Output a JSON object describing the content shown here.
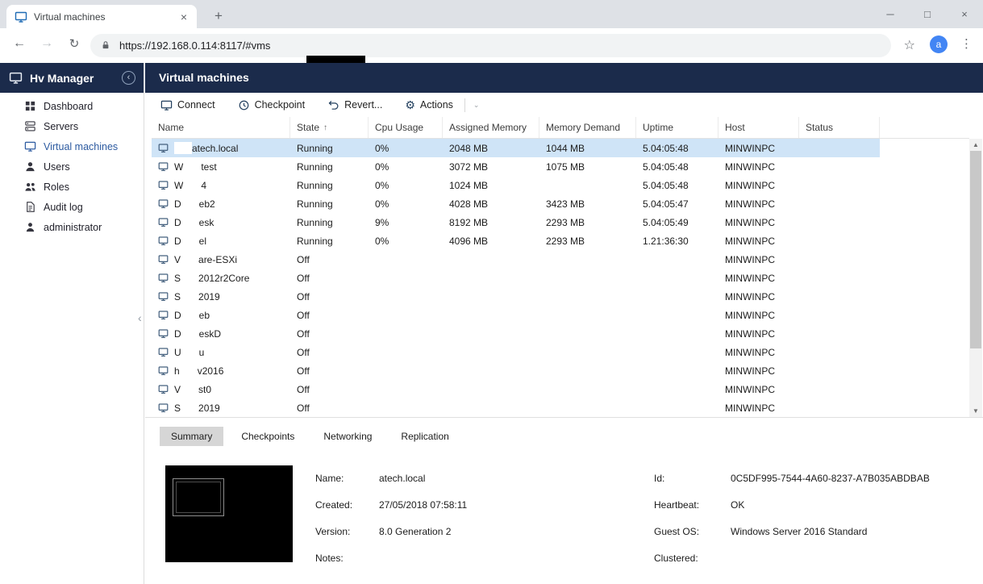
{
  "theme": {
    "navy": "#1b2b4b",
    "accent": "#2c5aa0",
    "row_selected": "#cfe4f7"
  },
  "browser": {
    "tab_title": "Virtual machines",
    "close_tab_glyph": "×",
    "new_tab_glyph": "+",
    "minimize_glyph": "─",
    "maximize_glyph": "□",
    "close_glyph": "×",
    "back_glyph": "←",
    "forward_glyph": "→",
    "reload_glyph": "↻",
    "url": "https://192.168.0.114:8117/#vms",
    "star_glyph": "☆",
    "avatar_letter": "a",
    "menu_glyph": "⋮"
  },
  "sidebar": {
    "title": "Hv Manager",
    "collapse_glyph": "‹",
    "items": [
      {
        "label": "Dashboard"
      },
      {
        "label": "Servers"
      },
      {
        "label": "Virtual machines",
        "selected": true
      },
      {
        "label": "Users"
      },
      {
        "label": "Roles"
      },
      {
        "label": "Audit log"
      },
      {
        "label": "administrator"
      }
    ]
  },
  "header": {
    "title": "Virtual machines"
  },
  "toolbar": {
    "buttons": [
      {
        "label": "Connect"
      },
      {
        "label": "Checkpoint"
      },
      {
        "label": "Revert..."
      },
      {
        "label": "Actions"
      }
    ],
    "chevron_glyph": "⌄"
  },
  "table": {
    "columns": [
      "Name",
      "State",
      "Cpu Usage",
      "Assigned Memory",
      "Memory Demand",
      "Uptime",
      "Host",
      "Status"
    ],
    "sort_column": "State",
    "sort_glyph": "↑",
    "rows": [
      {
        "pre": "",
        "post": "atech.local",
        "state": "Running",
        "cpu": "0%",
        "assigned": "2048 MB",
        "demand": "1044 MB",
        "uptime": "5.04:05:48",
        "host": "MINWINPC",
        "status": "",
        "selected": true
      },
      {
        "pre": "W",
        "post": "test",
        "state": "Running",
        "cpu": "0%",
        "assigned": "3072 MB",
        "demand": "1075 MB",
        "uptime": "5.04:05:48",
        "host": "MINWINPC",
        "status": ""
      },
      {
        "pre": "W",
        "post": "4",
        "state": "Running",
        "cpu": "0%",
        "assigned": "1024 MB",
        "demand": "",
        "uptime": "5.04:05:48",
        "host": "MINWINPC",
        "status": ""
      },
      {
        "pre": "D",
        "post": "eb2",
        "state": "Running",
        "cpu": "0%",
        "assigned": "4028 MB",
        "demand": "3423 MB",
        "uptime": "5.04:05:47",
        "host": "MINWINPC",
        "status": ""
      },
      {
        "pre": "D",
        "post": "esk",
        "state": "Running",
        "cpu": "9%",
        "assigned": "8192 MB",
        "demand": "2293 MB",
        "uptime": "5.04:05:49",
        "host": "MINWINPC",
        "status": ""
      },
      {
        "pre": "D",
        "post": "el",
        "state": "Running",
        "cpu": "0%",
        "assigned": "4096 MB",
        "demand": "2293 MB",
        "uptime": "1.21:36:30",
        "host": "MINWINPC",
        "status": ""
      },
      {
        "pre": "V",
        "post": "are-ESXi",
        "state": "Off",
        "cpu": "",
        "assigned": "",
        "demand": "",
        "uptime": "",
        "host": "MINWINPC",
        "status": ""
      },
      {
        "pre": "S",
        "post": "2012r2Core",
        "state": "Off",
        "cpu": "",
        "assigned": "",
        "demand": "",
        "uptime": "",
        "host": "MINWINPC",
        "status": ""
      },
      {
        "pre": "S",
        "post": "2019",
        "state": "Off",
        "cpu": "",
        "assigned": "",
        "demand": "",
        "uptime": "",
        "host": "MINWINPC",
        "status": ""
      },
      {
        "pre": "D",
        "post": "eb",
        "state": "Off",
        "cpu": "",
        "assigned": "",
        "demand": "",
        "uptime": "",
        "host": "MINWINPC",
        "status": ""
      },
      {
        "pre": "D",
        "post": "eskD",
        "state": "Off",
        "cpu": "",
        "assigned": "",
        "demand": "",
        "uptime": "",
        "host": "MINWINPC",
        "status": ""
      },
      {
        "pre": "U",
        "post": "u",
        "state": "Off",
        "cpu": "",
        "assigned": "",
        "demand": "",
        "uptime": "",
        "host": "MINWINPC",
        "status": ""
      },
      {
        "pre": "h",
        "post": "v2016",
        "state": "Off",
        "cpu": "",
        "assigned": "",
        "demand": "",
        "uptime": "",
        "host": "MINWINPC",
        "status": ""
      },
      {
        "pre": "V",
        "post": "st0",
        "state": "Off",
        "cpu": "",
        "assigned": "",
        "demand": "",
        "uptime": "",
        "host": "MINWINPC",
        "status": ""
      },
      {
        "pre": "S",
        "post": "2019",
        "state": "Off",
        "cpu": "",
        "assigned": "",
        "demand": "",
        "uptime": "",
        "host": "MINWINPC",
        "status": ""
      }
    ]
  },
  "tabs": {
    "items": [
      "Summary",
      "Checkpoints",
      "Networking",
      "Replication"
    ],
    "selected": "Summary"
  },
  "details": {
    "left": [
      {
        "label": "Name:",
        "value": "atech.local"
      },
      {
        "label": "Created:",
        "value": "27/05/2018 07:58:11"
      },
      {
        "label": "Version:",
        "value": "8.0 Generation 2"
      },
      {
        "label": "Notes:",
        "value": ""
      }
    ],
    "right": [
      {
        "label": "Id:",
        "value": "0C5DF995-7544-4A60-8237-A7B035ABDBAB"
      },
      {
        "label": "Heartbeat:",
        "value": "OK"
      },
      {
        "label": "Guest OS:",
        "value": "Windows Server 2016 Standard"
      },
      {
        "label": "Clustered:",
        "value": ""
      }
    ]
  }
}
